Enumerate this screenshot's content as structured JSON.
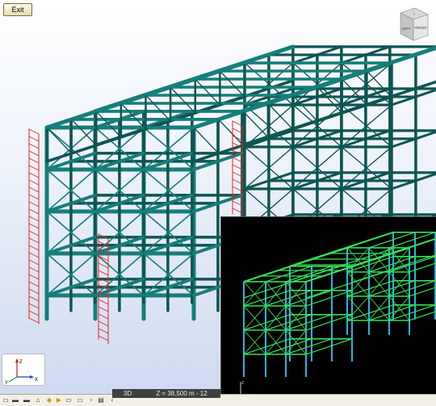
{
  "toolbar": {
    "exit_label": "Exit"
  },
  "nav_cube": {
    "top_face": "T",
    "left_face": "LEFT",
    "front_face": "FRONT"
  },
  "axis_indicator": {
    "z_label": "Z",
    "x_label": "X",
    "y_label": "Y"
  },
  "status": {
    "view_mode": "3D",
    "coordinate": "Z = 38,500 m - 12"
  },
  "colors": {
    "member": "#167e7b",
    "member_dark": "#0c5552",
    "ladder": "#e02424",
    "inset_beam": "#35e05a",
    "inset_column": "#25b8d8"
  },
  "icons": [
    "save-icon",
    "undo-icon",
    "redo-icon",
    "print-icon",
    "zoom-icon",
    "select-icon",
    "snap-icon",
    "measure-icon",
    "grid-icon",
    "layer-icon",
    "render-icon",
    "scroll-left-icon"
  ]
}
